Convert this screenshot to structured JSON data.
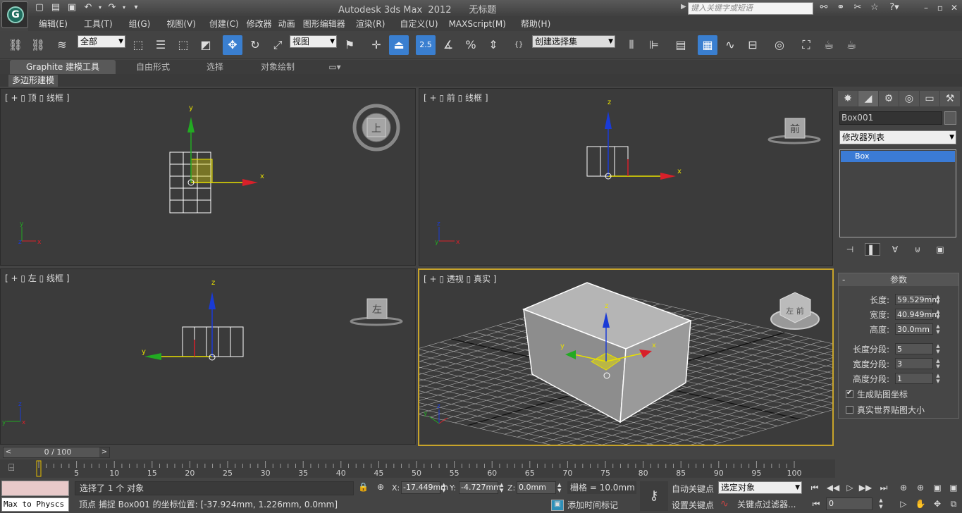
{
  "app": {
    "logo_letter": "G",
    "title": "Autodesk 3ds Max  2012      无标题",
    "search_placeholder": "键入关键字或短语"
  },
  "quick_access": [
    {
      "icon": "new-file-icon",
      "glyph": "▢"
    },
    {
      "icon": "open-folder-icon",
      "glyph": "🗁"
    },
    {
      "icon": "save-icon",
      "glyph": "💾"
    },
    {
      "icon": "undo-icon",
      "glyph": "↶"
    },
    {
      "icon": "redo-icon",
      "glyph": "↷"
    },
    {
      "icon": "customize-dropdown-icon",
      "glyph": "▾"
    }
  ],
  "title_icons": [
    {
      "icon": "binoculars-icon",
      "glyph": "⚲"
    },
    {
      "icon": "communication-center-icon",
      "glyph": "✉"
    },
    {
      "icon": "subscription-icon",
      "glyph": "✂"
    },
    {
      "icon": "favorites-star-icon",
      "glyph": "☆"
    },
    {
      "icon": "help-icon",
      "glyph": "?"
    }
  ],
  "window_controls": [
    "–",
    "▫",
    "✕"
  ],
  "menu": [
    "编辑(E)",
    "工具(T)",
    "组(G)",
    "视图(V)",
    "创建(C)",
    "修改器",
    "动画",
    "图形编辑器",
    "渲染(R)",
    "自定义(U)",
    "MAXScript(M)",
    "帮助(H)"
  ],
  "toolbar": {
    "selection_filter": "全部",
    "ref_coord": "视图",
    "named_selection": "创建选择集",
    "angle_snap_label": "2.5"
  },
  "ribbon": {
    "tabs": [
      "Graphite 建模工具",
      "自由形式",
      "选择",
      "对象绘制"
    ],
    "active_tab": 0,
    "sub_tab": "多边形建模"
  },
  "viewports": [
    {
      "id": "top",
      "label": "[ + ▯ 顶 ▯ 线框 ]",
      "cube_label": "上"
    },
    {
      "id": "front",
      "label": "[ + ▯ 前 ▯ 线框 ]",
      "cube_label": "前"
    },
    {
      "id": "left",
      "label": "[ + ▯ 左 ▯ 线框 ]",
      "cube_label": "左"
    },
    {
      "id": "persp",
      "label": "[ + ▯ 透视 ▯ 真实 ]",
      "cube_label": "左 前"
    }
  ],
  "axis_labels": {
    "x": "x",
    "y": "y",
    "z": "z"
  },
  "command_panel": {
    "object_name": "Box001",
    "modifier_list": "修改器列表",
    "stack_item": "Box",
    "rollout_title": "参数",
    "params": [
      {
        "label": "长度:",
        "value": "59.529mm"
      },
      {
        "label": "宽度:",
        "value": "40.949mm"
      },
      {
        "label": "高度:",
        "value": "30.0mm"
      },
      {
        "label": "长度分段:",
        "value": "5"
      },
      {
        "label": "宽度分段:",
        "value": "3"
      },
      {
        "label": "高度分段:",
        "value": "1"
      }
    ],
    "checkboxes": [
      {
        "label": "生成贴图坐标",
        "checked": true
      },
      {
        "label": "真实世界贴图大小",
        "checked": false
      }
    ]
  },
  "timeline": {
    "slider_label": "0 / 100",
    "ticks": [
      "0",
      "5",
      "10",
      "15",
      "20",
      "25",
      "30",
      "35",
      "40",
      "45",
      "50",
      "55",
      "60",
      "65",
      "70",
      "75",
      "80",
      "85",
      "90",
      "95",
      "100"
    ]
  },
  "status": {
    "maxscript_line": "Max to Physcs (",
    "selection_status": "选择了 1 个 对象",
    "prompt": "顶点 捕捉 Box001 的坐标位置:  [-37.924mm, 1.226mm, 0.0mm]",
    "x_label": "X:",
    "x_value": "-17.449mm",
    "y_label": "Y:",
    "y_value": "-4.727mm",
    "z_label": "Z:",
    "z_value": "0.0mm",
    "grid": "栅格 = 10.0mm",
    "add_time_tag": "添加时间标记",
    "auto_key": "自动关键点",
    "set_key": "设置关键点",
    "key_mode_select": "选定对象",
    "key_filters": "关键点过滤器...",
    "current_frame": "0"
  },
  "colors": {
    "axis_x": "#d8202a",
    "axis_y": "#22aa22",
    "axis_z": "#1a3bd6",
    "gizmo_yellow": "#e8e000",
    "active_viewport_border": "#c8a42a",
    "selection_blue": "#3b7bd5"
  }
}
